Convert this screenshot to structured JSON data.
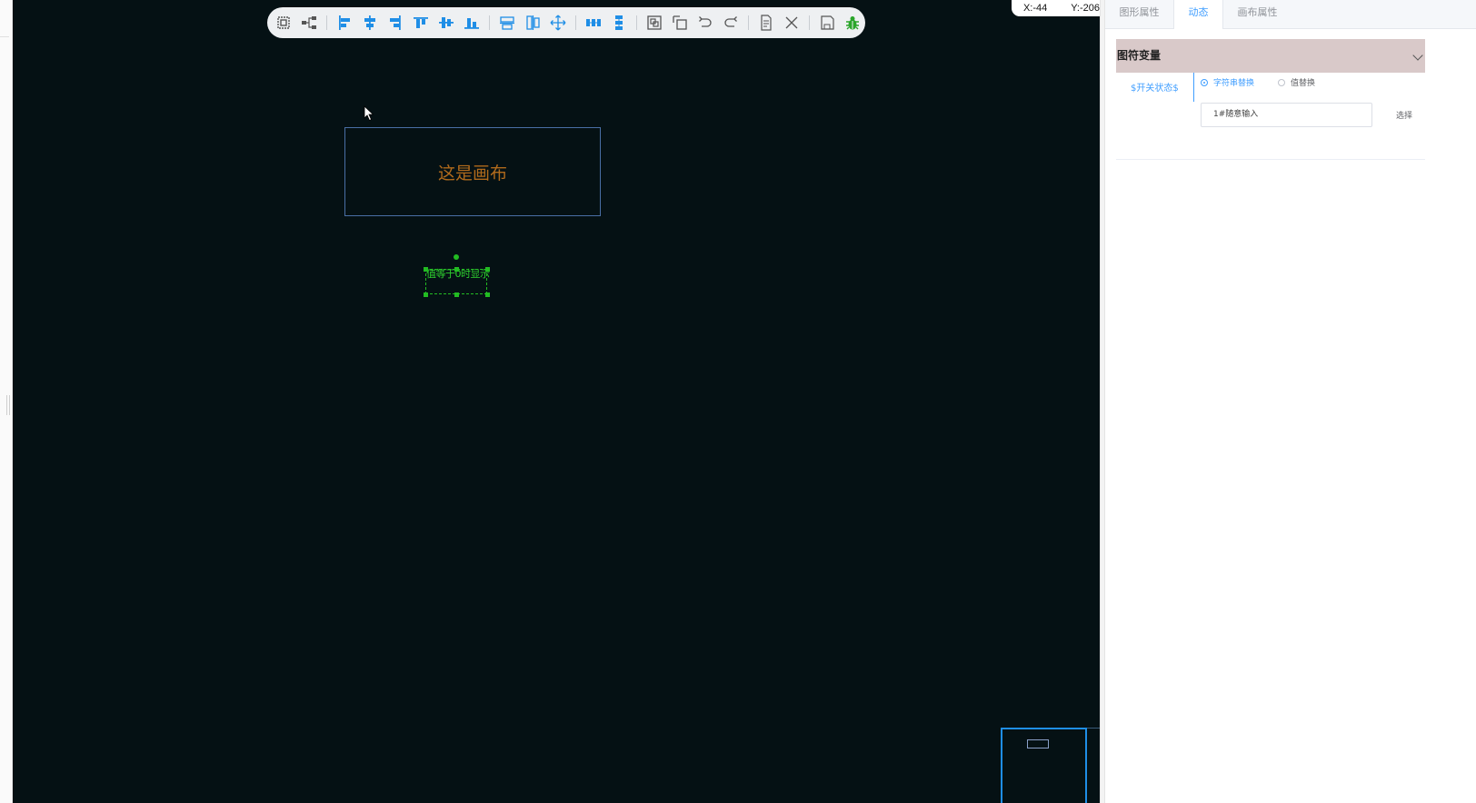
{
  "coords": {
    "x": "X:-44",
    "y": "Y:-206"
  },
  "toolbar": {
    "icons": [
      "select-region-icon",
      "connect-icon",
      "align-left-icon",
      "align-center-icon",
      "align-right-icon",
      "align-top-icon",
      "align-middle-icon",
      "align-bottom-icon",
      "same-width-icon",
      "same-height-icon",
      "move-icon",
      "distribute-horizontal-icon",
      "distribute-vertical-icon",
      "group-icon",
      "ungroup-icon",
      "undo-icon",
      "redo-icon",
      "document-icon",
      "close-icon",
      "save-icon",
      "debug-icon"
    ],
    "colors": {
      "accent": "#1f8ee6",
      "gray": "#555555",
      "debug": "#2aa52a"
    }
  },
  "canvas": {
    "background": "#051114",
    "box_text": "这是画布",
    "selected_text": "值等于0时显示"
  },
  "panel": {
    "tabs": [
      "图形属性",
      "动态",
      "画布属性"
    ],
    "active_tab": "动态",
    "section_title": "图符变量",
    "variable": "$开关状态$",
    "radio_options": [
      "字符串替换",
      "值替换"
    ],
    "selected_radio": "字符串替换",
    "input_value": "1#随意输入",
    "select_button": "选择"
  }
}
